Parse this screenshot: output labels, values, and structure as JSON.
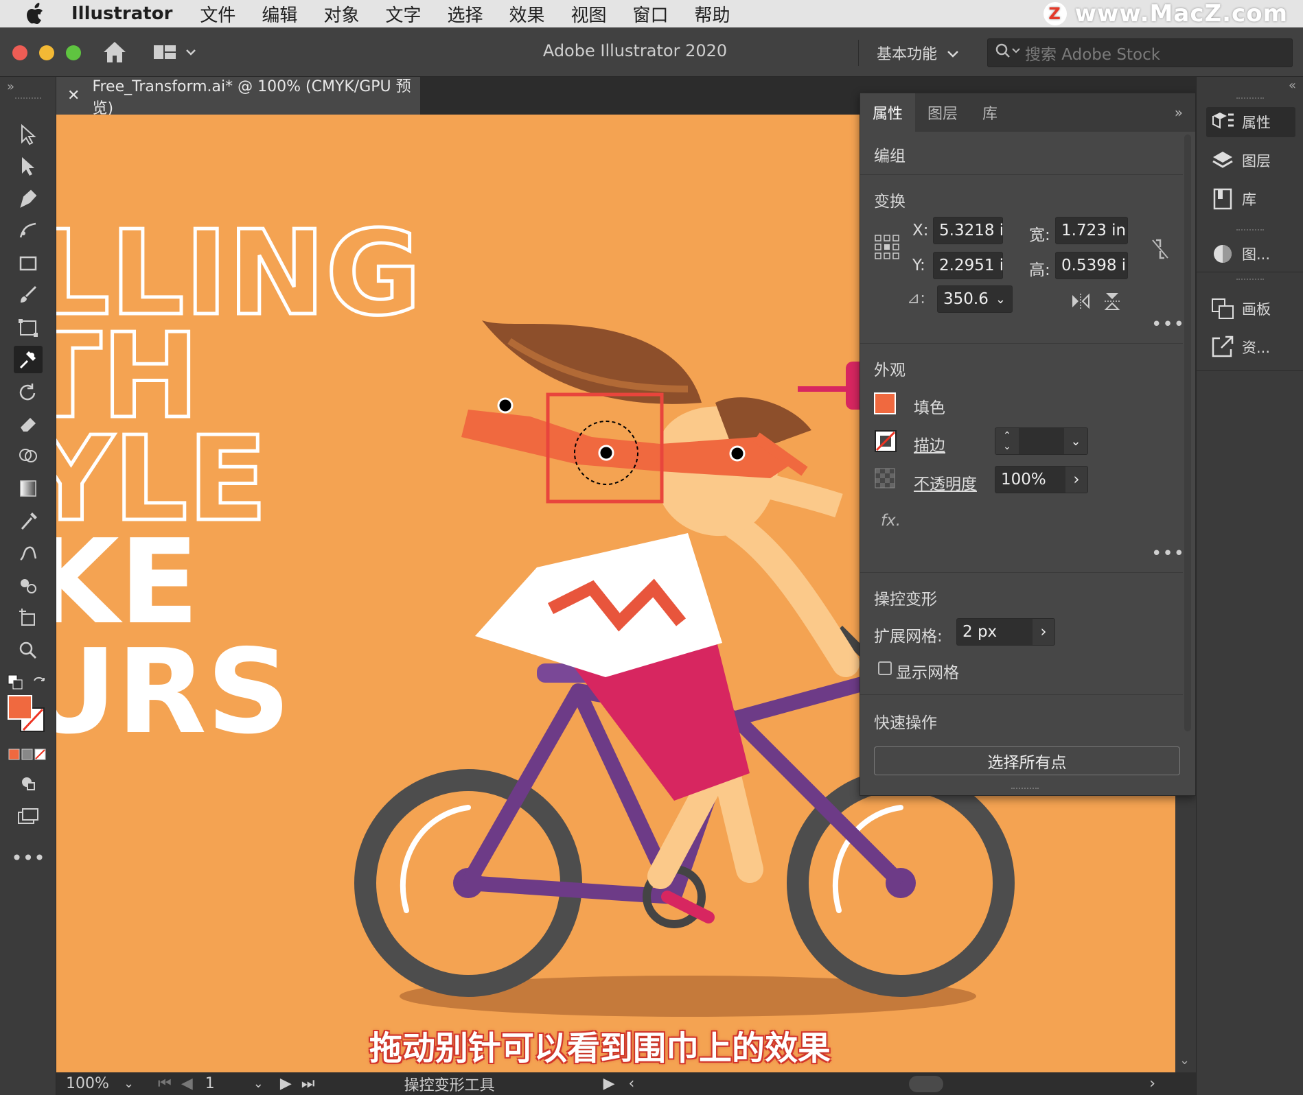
{
  "menubar": {
    "app_name": "Illustrator",
    "items": [
      "文件",
      "编辑",
      "对象",
      "文字",
      "选择",
      "效果",
      "视图",
      "窗口",
      "帮助"
    ]
  },
  "watermark": {
    "badge": "Z",
    "text": "www.MacZ.com"
  },
  "titlebar": {
    "title": "Adobe Illustrator 2020",
    "workspace": "基本功能",
    "search_placeholder": "搜索 Adobe Stock"
  },
  "document": {
    "tab_label": "Free_Transform.ai* @ 100% (CMYK/GPU 预览)"
  },
  "artwork": {
    "lines": [
      "LLING",
      "TH",
      "YLE",
      "KE",
      "URS"
    ]
  },
  "subtitle": "拖动别针可以看到围巾上的效果",
  "status": {
    "zoom": "100%",
    "artboard": "1",
    "tool": "操控变形工具"
  },
  "properties": {
    "tabs": [
      "属性",
      "图层",
      "库"
    ],
    "object_type": "编组",
    "transform": {
      "title": "变换",
      "x_label": "X:",
      "x": "5.3218 i",
      "y_label": "Y:",
      "y": "2.2951 i",
      "w_label": "宽:",
      "w": "1.723 in",
      "h_label": "高:",
      "h": "0.5398 ir",
      "angle_label": "⊿:",
      "angle": "350.6"
    },
    "appearance": {
      "title": "外观",
      "fill_label": "填色",
      "stroke_label": "描边",
      "opacity_label": "不透明度",
      "opacity": "100%",
      "fx": "fx."
    },
    "puppet": {
      "title": "操控变形",
      "expand_label": "扩展网格:",
      "expand": "2 px",
      "show_mesh": "显示网格"
    },
    "quick": {
      "title": "快速操作",
      "select_all": "选择所有点"
    }
  },
  "dock": {
    "items": [
      "属性",
      "图层",
      "库",
      "图...",
      "画板",
      "资..."
    ]
  },
  "colors": {
    "canvas": "#f4a352",
    "fill_swatch": "#f0693f",
    "highlight": "#e8453c"
  }
}
